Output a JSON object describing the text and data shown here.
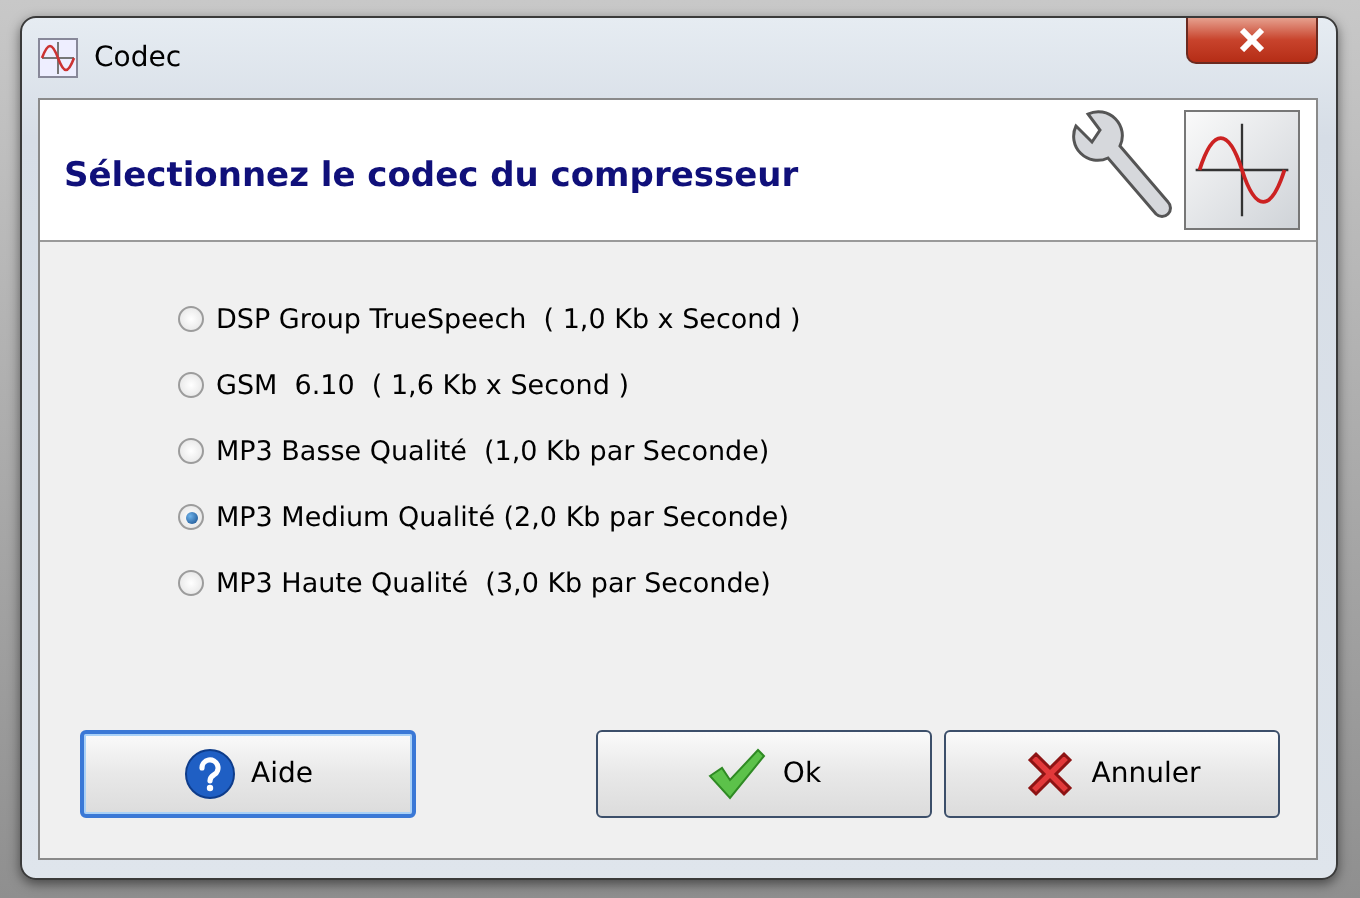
{
  "window": {
    "title": "Codec"
  },
  "header": {
    "title": "Sélectionnez le codec du compresseur"
  },
  "codecs": [
    {
      "label": "DSP Group TrueSpeech  ( 1,0 Kb x Second )",
      "selected": false
    },
    {
      "label": "GSM  6.10  ( 1,6 Kb x Second )",
      "selected": false
    },
    {
      "label": "MP3 Basse Qualité  (1,0 Kb par Seconde)",
      "selected": false
    },
    {
      "label": "MP3 Medium Qualité (2,0 Kb par Seconde)",
      "selected": true
    },
    {
      "label": "MP3 Haute Qualité  (3,0 Kb par Seconde)",
      "selected": false
    }
  ],
  "buttons": [
    {
      "kind": "help",
      "label": "Aide",
      "focused": true
    },
    {
      "kind": "ok",
      "label": "Ok",
      "focused": false
    },
    {
      "kind": "cancel",
      "label": "Annuler",
      "focused": false
    }
  ]
}
